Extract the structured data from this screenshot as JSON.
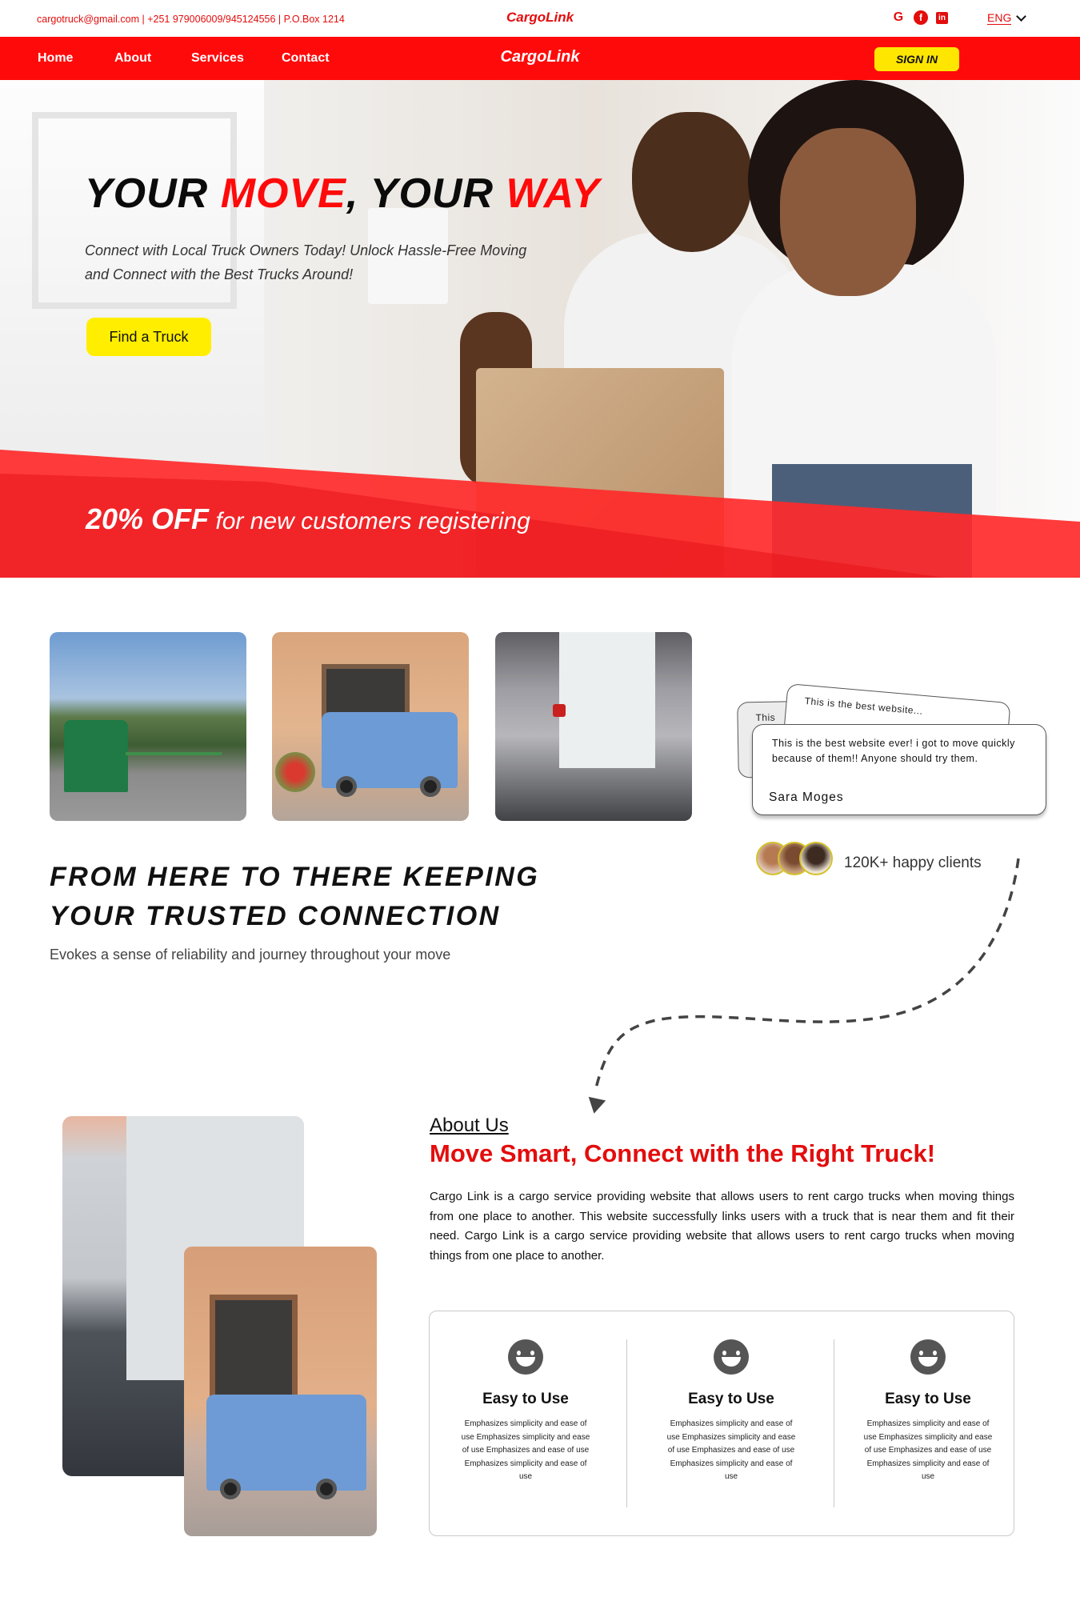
{
  "topbar": {
    "contact": "cargotruck@gmail.com  |  +251 979006009/945124556  |  P.O.Box 1214",
    "brand": "CargoLink",
    "language": "ENG",
    "socials": [
      "google-icon",
      "facebook-icon",
      "linkedin-icon"
    ]
  },
  "nav": {
    "items": [
      "Home",
      "About",
      "Services",
      "Contact"
    ],
    "brand": "CargoLink",
    "signin": "SIGN IN"
  },
  "hero": {
    "title_1": "YOUR ",
    "title_2": "MOVE",
    "title_3": ", YOUR ",
    "title_4": "WAY",
    "subtitle": "Connect with Local Truck Owners Today! Unlock Hassle-Free Moving and Connect with the Best Trucks Around!",
    "cta": "Find a Truck",
    "promo_bold": "20% OFF",
    "promo_rest": " for new customers registering"
  },
  "testimonial": {
    "back_text_1": "This",
    "back_text_2": "This is the best website...",
    "quote": "This is the best website ever! i got to move quickly because of them!! Anyone should try them.",
    "name": "Sara Moges",
    "happy_clients": "120K+ happy clients"
  },
  "tagline": {
    "line1": "FROM HERE TO THERE KEEPING",
    "line2": "YOUR TRUSTED CONNECTION",
    "sub": "Evokes a sense of reliability and journey throughout your move"
  },
  "about": {
    "heading": "About Us",
    "title": "Move Smart, Connect with the Right Truck!",
    "body": "Cargo Link is a cargo service providing website that allows users to rent cargo trucks when moving things from one place to another. This website successfully links users with a truck that is near them and fit their need. Cargo Link is a cargo service providing website that allows users to rent cargo trucks when moving things from one place to another.",
    "features": [
      {
        "title": "Easy to Use",
        "text": "Emphasizes simplicity and ease of use Emphasizes simplicity and ease of use Emphasizes and ease of use Emphasizes simplicity and ease of use"
      },
      {
        "title": "Easy to Use",
        "text": "Emphasizes simplicity and ease of use Emphasizes simplicity and ease of use Emphasizes and ease of use Emphasizes simplicity and ease of use"
      },
      {
        "title": "Easy to Use",
        "text": "Emphasizes simplicity and ease of use Emphasizes simplicity and ease of use Emphasizes and ease of use Emphasizes simplicity and ease of use"
      }
    ]
  },
  "colors": {
    "brand_red": "#ff0a0a",
    "accent_yellow": "#ffee00"
  }
}
